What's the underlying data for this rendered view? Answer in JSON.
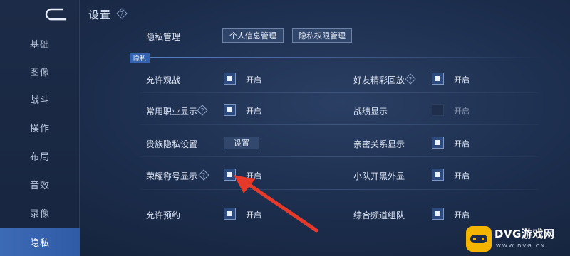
{
  "header": {
    "title": "设置"
  },
  "sidebar": {
    "items": [
      {
        "label": "基础"
      },
      {
        "label": "图像"
      },
      {
        "label": "战斗"
      },
      {
        "label": "操作"
      },
      {
        "label": "布局"
      },
      {
        "label": "音效"
      },
      {
        "label": "录像"
      },
      {
        "label": "隐私",
        "active": true
      }
    ]
  },
  "privacy_management": {
    "label": "隐私管理",
    "btn_personal": "个人信息管理",
    "btn_permissions": "隐私权限管理"
  },
  "section": {
    "label": "隐私"
  },
  "rows": {
    "allow_spectate": {
      "label": "允许观战",
      "state": "开启",
      "checked": true
    },
    "friend_highlights": {
      "label": "好友精彩回放",
      "state": "开启",
      "checked": true
    },
    "common_job": {
      "label": "常用职业显示",
      "state": "开启",
      "checked": true
    },
    "battle_record": {
      "label": "战绩显示",
      "state": "开启",
      "checked": false
    },
    "noble_privacy": {
      "label": "贵族隐私设置",
      "button": "设置"
    },
    "intimacy": {
      "label": "亲密关系显示",
      "state": "开启",
      "checked": true
    },
    "glory_title": {
      "label": "荣耀称号显示",
      "state": "开启",
      "checked": true
    },
    "squad_status": {
      "label": "小队开黑外显",
      "state": "开启",
      "checked": true
    },
    "allow_reserve": {
      "label": "允许预约",
      "state": "开启",
      "checked": true
    },
    "channel_team": {
      "label": "综合频道组队",
      "state": "开启",
      "checked": true
    }
  },
  "annotation": {
    "color": "#e53a2a",
    "icon": "red-arrow"
  },
  "watermark": {
    "title": "DVG游戏网",
    "subtitle": "WWW.DVG.CN",
    "color": "#f4b400"
  },
  "colors": {
    "accent": "#3563b0",
    "active_nav": "#2f5aa6",
    "checkbox_on": "#2c4a80"
  }
}
